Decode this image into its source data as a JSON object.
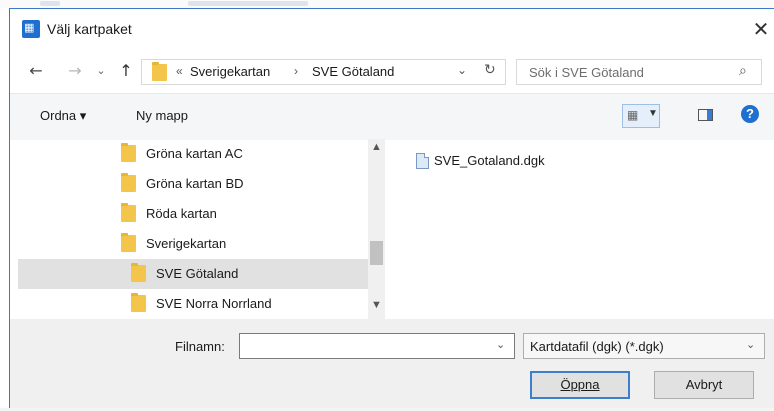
{
  "window": {
    "title": "Välj kartpaket",
    "app_icon": "app-icon",
    "close_symbol": "✕"
  },
  "nav": {
    "back_symbol": "←",
    "forward_symbol": "→",
    "recent_symbol": "⌄",
    "up_symbol": "↑",
    "breadcrumb": {
      "overflow": "«",
      "segments": [
        "Sverigekartan",
        "SVE Götaland"
      ],
      "separator": "›"
    },
    "address_dropdown_symbol": "⌄",
    "refresh_symbol": "↻",
    "search_placeholder": "Sök i SVE Götaland",
    "search_icon": "⌕"
  },
  "toolbar": {
    "organize_label": "Ordna ▾",
    "new_folder_label": "Ny mapp",
    "help_label": "?"
  },
  "tree": {
    "items": [
      {
        "label": "Gröna kartan AC"
      },
      {
        "label": "Gröna kartan BD"
      },
      {
        "label": "Röda kartan"
      },
      {
        "label": "Sverigekartan"
      },
      {
        "label": "SVE Götaland",
        "selected": true
      },
      {
        "label": "SVE Norra Norrland"
      }
    ]
  },
  "files": [
    {
      "name": "SVE_Gotaland.dgk"
    }
  ],
  "footer": {
    "filename_label": "Filnamn:",
    "filename_value": "",
    "filter_value": "Kartdatafil (dgk) (*.dgk)",
    "open_label": "Öppna",
    "cancel_label": "Avbryt"
  },
  "colors": {
    "accent": "#1e6fd0",
    "selection": "#e1e1e1",
    "folder": "#f3c54b"
  }
}
